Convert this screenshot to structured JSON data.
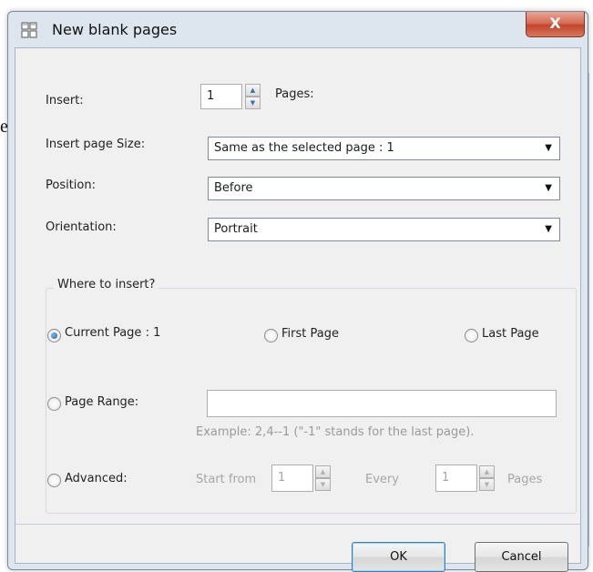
{
  "window": {
    "title": "New blank pages",
    "close_label": "X"
  },
  "insert": {
    "label": "Insert:",
    "value": "1",
    "suffix": "Pages:"
  },
  "page_size": {
    "label": "Insert page Size:",
    "selected": "Same as the selected page : 1"
  },
  "position": {
    "label": "Position:",
    "selected": "Before"
  },
  "orientation": {
    "label": "Orientation:",
    "selected": "Portrait"
  },
  "where": {
    "legend": "Where to insert?",
    "current_page": {
      "label": "Current Page : 1",
      "checked": true
    },
    "first_page": {
      "label": "First Page",
      "checked": false
    },
    "last_page": {
      "label": "Last Page",
      "checked": false
    },
    "page_range": {
      "label": "Page Range:",
      "checked": false,
      "value": ""
    },
    "range_hint": "Example: 2,4--1 (\"-1\" stands for the last page).",
    "advanced": {
      "label": "Advanced:",
      "checked": false,
      "start_from_label": "Start from",
      "start_value": "1",
      "every_label": "Every",
      "every_value": "1",
      "pages_label": "Pages"
    }
  },
  "buttons": {
    "ok": "OK",
    "cancel": "Cancel"
  },
  "background": {
    "fragment_left": "e"
  },
  "colors": {
    "window_frame": "#dde6ef",
    "client_bg": "#f0f0f0",
    "close_button": "#c4452c",
    "radio_selected": "#1a5ea8"
  }
}
